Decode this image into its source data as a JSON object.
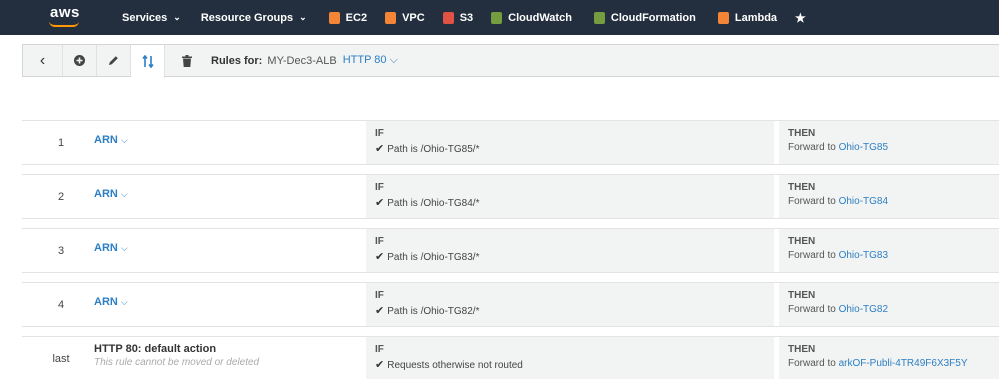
{
  "nav": {
    "logo": "aws",
    "services": "Services",
    "resource_groups": "Resource Groups",
    "shortcuts": [
      {
        "label": "EC2",
        "color": "#f58536"
      },
      {
        "label": "VPC",
        "color": "#f58536"
      },
      {
        "label": "S3",
        "color": "#e05243"
      },
      {
        "label": "CloudWatch",
        "color": "#759c3e"
      },
      {
        "label": "CloudFormation",
        "color": "#759c3e"
      },
      {
        "label": "Lambda",
        "color": "#f58536"
      }
    ],
    "pin_icon": "★"
  },
  "toolbar": {
    "rules_for_label": "Rules for:",
    "load_balancer": "MY-Dec3-ALB",
    "listener": "HTTP 80",
    "active_tool": "reorder-icon"
  },
  "rules": [
    {
      "num": "1",
      "name": "ARN",
      "if_label": "IF",
      "condition": "Path is /Ohio-TG85/*",
      "then_label": "THEN",
      "action_prefix": "Forward to",
      "target": "Ohio-TG85"
    },
    {
      "num": "2",
      "name": "ARN",
      "if_label": "IF",
      "condition": "Path is /Ohio-TG84/*",
      "then_label": "THEN",
      "action_prefix": "Forward to",
      "target": "Ohio-TG84"
    },
    {
      "num": "3",
      "name": "ARN",
      "if_label": "IF",
      "condition": "Path is /Ohio-TG83/*",
      "then_label": "THEN",
      "action_prefix": "Forward to",
      "target": "Ohio-TG83"
    },
    {
      "num": "4",
      "name": "ARN",
      "if_label": "IF",
      "condition": "Path is /Ohio-TG82/*",
      "then_label": "THEN",
      "action_prefix": "Forward to",
      "target": "Ohio-TG82"
    }
  ],
  "default_rule": {
    "num": "last",
    "name": "HTTP 80: default action",
    "note": "This rule cannot be moved or deleted",
    "if_label": "IF",
    "condition": "Requests otherwise not routed",
    "then_label": "THEN",
    "action_prefix": "Forward to",
    "target": "arkOF-Publi-4TR49F6X3F5Y"
  }
}
